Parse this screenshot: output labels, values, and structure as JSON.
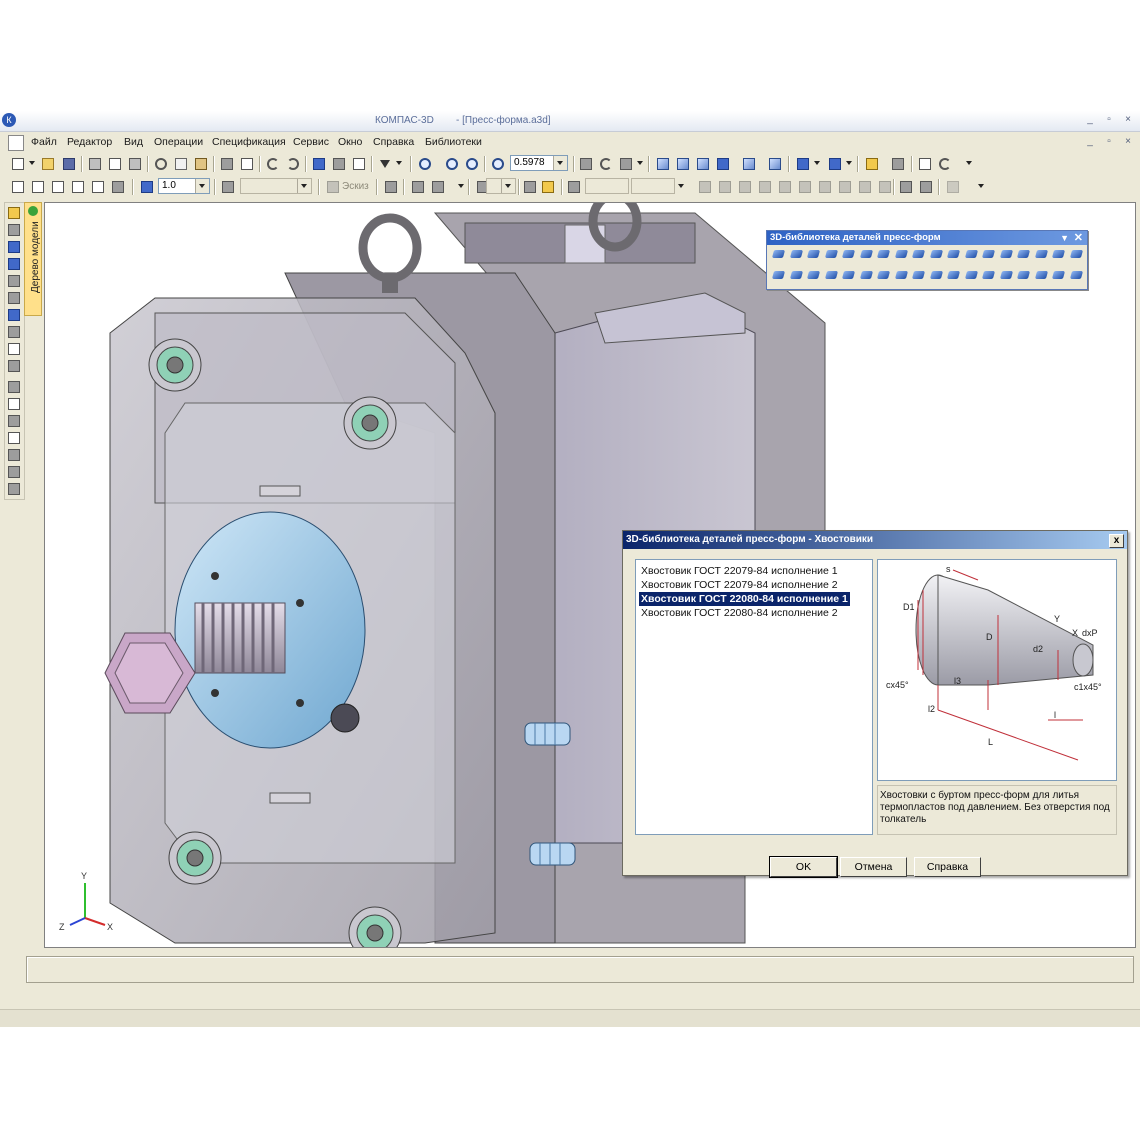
{
  "window": {
    "app_title": "КОМПАС-3D",
    "doc_title": "- [Пресс-форма.a3d]",
    "controls": {
      "minimize": "_",
      "restore": "▫",
      "close": "×"
    }
  },
  "menu": {
    "items": [
      "Файл",
      "Редактор",
      "Вид",
      "Операции",
      "Спецификация",
      "Сервис",
      "Окно",
      "Справка",
      "Библиотеки"
    ],
    "doc_controls": {
      "minimize": "_",
      "restore": "▫",
      "close": "×"
    }
  },
  "toolbar1": {
    "zoom_value": "0.5978"
  },
  "toolbar2": {
    "step_value": "1.0",
    "style_field": "",
    "sketch_label": "Эскиз",
    "coord1": "",
    "coord2": ""
  },
  "side_panel": {
    "model_tree_label": "Дерево модели"
  },
  "viewport": {
    "axes": {
      "x": "X",
      "y": "Y",
      "z": "Z"
    }
  },
  "library_toolbar": {
    "title": "3D-библиотека деталей пресс-форм",
    "dropdown_glyph": "▼",
    "close_glyph": "✕"
  },
  "dialog": {
    "title": "3D-библиотека деталей пресс-форм - Хвостовики",
    "close_glyph": "x",
    "items": [
      "Хвостовик ГОСТ 22079-84 исполнение 1",
      "Хвостовик ГОСТ 22079-84 исполнение 2",
      "Хвостовик ГОСТ 22080-84 исполнение 1",
      "Хвостовик ГОСТ 22080-84 исполнение 2"
    ],
    "selected_index": 2,
    "description": "Хвостовки с буртом пресс-форм для литья термопластов под давлением. Без отверстия под толкатель",
    "preview_labels": {
      "s": "s",
      "d1": "D1",
      "d": "D",
      "d2": "d2",
      "dxp": "dxP",
      "cx45": "cx45°",
      "c1x45": "c1x45°",
      "l3": "l3",
      "l2": "l2",
      "l": "l",
      "L": "L",
      "x": "X",
      "y": "Y"
    },
    "buttons": {
      "ok": "OK",
      "cancel": "Отмена",
      "help": "Справка"
    }
  },
  "colors": {
    "title_gradient_start": "#0a246a",
    "title_gradient_end": "#a6caf0",
    "panel_bg": "#ece9d8",
    "model_tree_tab": "#ffe08a",
    "selected_item": "#0a246a"
  }
}
